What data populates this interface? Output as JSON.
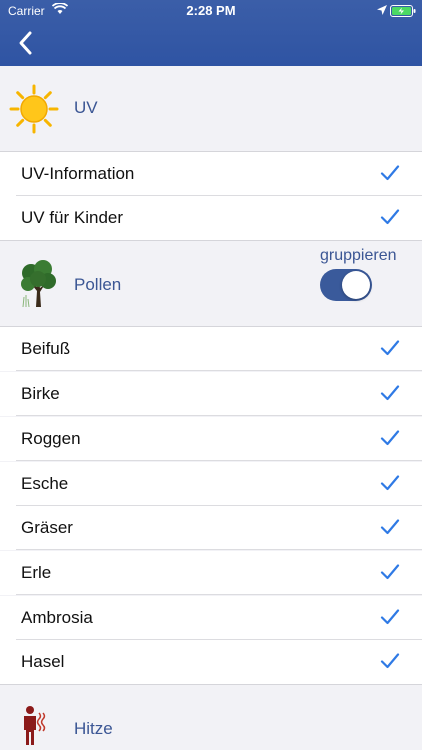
{
  "status_bar": {
    "carrier": "Carrier",
    "time": "2:28 PM"
  },
  "colors": {
    "header": "#2f54a3",
    "accent": "#2f7ae5",
    "section_text": "#3b5694",
    "toggle_on": "#3a5a9b"
  },
  "sections": {
    "uv": {
      "title": "UV",
      "icon": "sun-icon",
      "items": [
        {
          "label": "UV-Information",
          "checked": true
        },
        {
          "label": "UV für Kinder",
          "checked": true
        }
      ]
    },
    "pollen": {
      "title": "Pollen",
      "icon": "tree-icon",
      "toggle_label": "gruppieren",
      "toggle_on": true,
      "items": [
        {
          "label": "Beifuß",
          "checked": true
        },
        {
          "label": "Birke",
          "checked": true
        },
        {
          "label": "Roggen",
          "checked": true
        },
        {
          "label": "Esche",
          "checked": true
        },
        {
          "label": "Gräser",
          "checked": true
        },
        {
          "label": "Erle",
          "checked": true
        },
        {
          "label": "Ambrosia",
          "checked": true
        },
        {
          "label": "Hasel",
          "checked": true
        }
      ]
    },
    "hitze": {
      "title": "Hitze",
      "icon": "heat-person-icon"
    }
  }
}
